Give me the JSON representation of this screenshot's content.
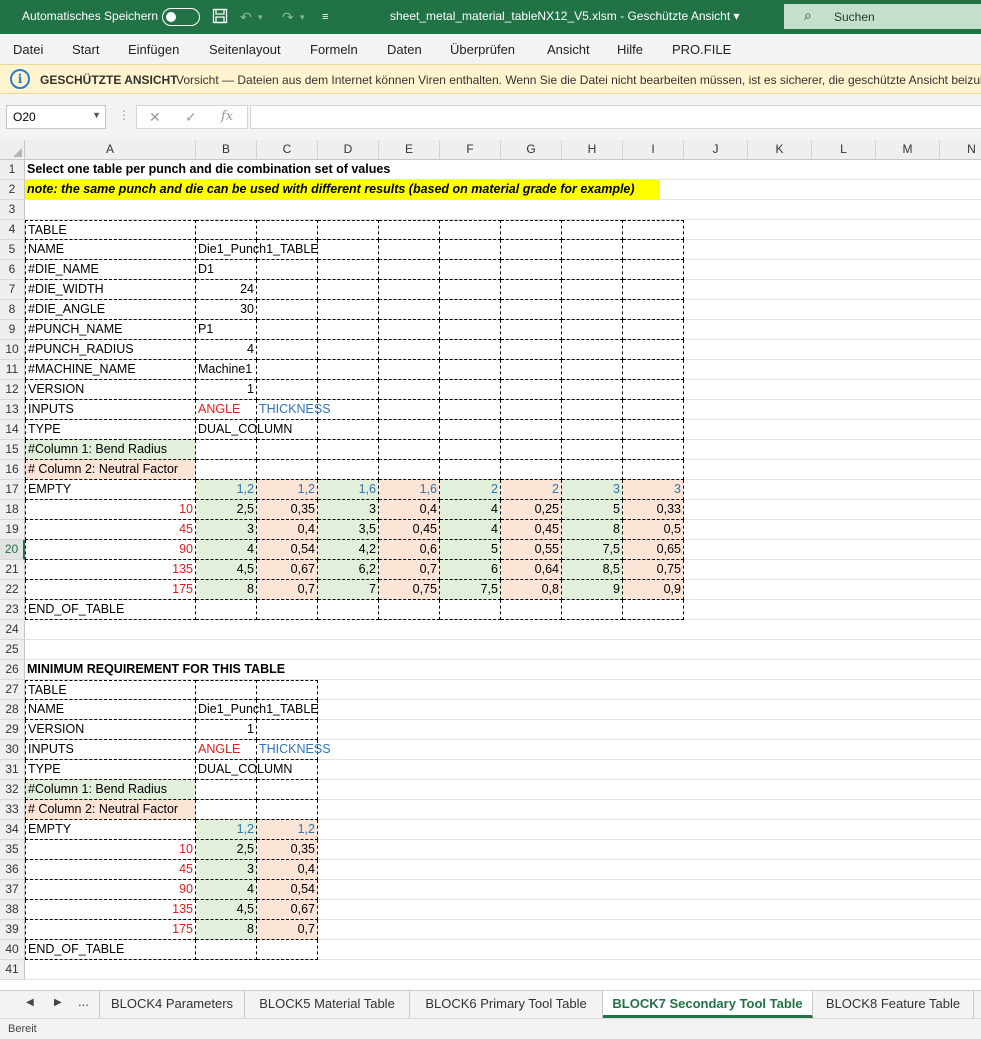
{
  "titlebar": {
    "autosave_label": "Automatisches Speichern",
    "document_title": "sheet_metal_material_tableNX12_V5.xlsm  -  Geschützte Ansicht  ▾",
    "search_label": "Suchen"
  },
  "menu": [
    "Datei",
    "Start",
    "Einfügen",
    "Seitenlayout",
    "Formeln",
    "Daten",
    "Überprüfen",
    "Ansicht",
    "Hilfe",
    "PRO.FILE"
  ],
  "protected_view": {
    "heading": "GESCHÜTZTE ANSICHT",
    "message": "Vorsicht — Dateien aus dem Internet können Viren enthalten. Wenn Sie die Datei nicht bearbeiten müssen, ist es sicherer, die geschützte Ansicht beizubeh"
  },
  "formula_bar": {
    "name_box": "O20",
    "formula": "",
    "fx": "fx"
  },
  "columns": [
    "A",
    "B",
    "C",
    "D",
    "E",
    "F",
    "G",
    "H",
    "I",
    "J",
    "K",
    "L",
    "M",
    "N"
  ],
  "rows": [
    "1",
    "2",
    "3",
    "4",
    "5",
    "6",
    "7",
    "8",
    "9",
    "10",
    "11",
    "12",
    "13",
    "14",
    "15",
    "16",
    "17",
    "18",
    "19",
    "20",
    "21",
    "22",
    "23",
    "24",
    "25",
    "26",
    "27",
    "28",
    "29",
    "30",
    "31",
    "32",
    "33",
    "34",
    "35",
    "36",
    "37",
    "38",
    "39",
    "40",
    "41"
  ],
  "selected_row": "20",
  "cells": {
    "A1": "Select one table per punch and die combination set of values",
    "A2": "note: the same punch and die can be used with different results (based on material grade for example)",
    "A4": "TABLE",
    "A5": "NAME",
    "B5": "Die1_Punch1_TABLE",
    "A6": "#DIE_NAME",
    "B6": "D1",
    "A7": "#DIE_WIDTH",
    "B7": "24",
    "A8": "#DIE_ANGLE",
    "B8": "30",
    "A9": "#PUNCH_NAME",
    "B9": "P1",
    "A10": "#PUNCH_RADIUS",
    "B10": "4",
    "A11": "#MACHINE_NAME",
    "B11": "Machine1",
    "A12": "VERSION",
    "B12": "1",
    "A13": "INPUTS",
    "B13": "ANGLE",
    "C13": "THICKNESS",
    "A14": "TYPE",
    "B14": "DUAL_COLUMN",
    "A15": "#Column 1: Bend Radius",
    "A16": "# Column 2: Neutral Factor",
    "A17": "EMPTY",
    "B17": "1,2",
    "C17": "1,2",
    "D17": "1,6",
    "E17": "1,6",
    "F17": "2",
    "G17": "2",
    "H17": "3",
    "I17": "3",
    "A18": "10",
    "B18": "2,5",
    "C18": "0,35",
    "D18": "3",
    "E18": "0,4",
    "F18": "4",
    "G18": "0,25",
    "H18": "5",
    "I18": "0,33",
    "A19": "45",
    "B19": "3",
    "C19": "0,4",
    "D19": "3,5",
    "E19": "0,45",
    "F19": "4",
    "G19": "0,45",
    "H19": "8",
    "I19": "0,5",
    "A20": "90",
    "B20": "4",
    "C20": "0,54",
    "D20": "4,2",
    "E20": "0,6",
    "F20": "5",
    "G20": "0,55",
    "H20": "7,5",
    "I20": "0,65",
    "A21": "135",
    "B21": "4,5",
    "C21": "0,67",
    "D21": "6,2",
    "E21": "0,7",
    "F21": "6",
    "G21": "0,64",
    "H21": "8,5",
    "I21": "0,75",
    "A22": "175",
    "B22": "8",
    "C22": "0,7",
    "D22": "7",
    "E22": "0,75",
    "F22": "7,5",
    "G22": "0,8",
    "H22": "9",
    "I22": "0,9",
    "A23": "END_OF_TABLE",
    "A26": "MINIMUM REQUIREMENT FOR THIS TABLE",
    "A27": "TABLE",
    "A28": "NAME",
    "B28": "Die1_Punch1_TABLE",
    "A29": "VERSION",
    "B29": "1",
    "A30": "INPUTS",
    "B30": "ANGLE",
    "C30": "THICKNESS",
    "A31": "TYPE",
    "B31": "DUAL_COLUMN",
    "A32": "#Column 1: Bend Radius",
    "A33": "# Column 2: Neutral Factor",
    "A34": "EMPTY",
    "B34": "1,2",
    "C34": "1,2",
    "A35": "10",
    "B35": "2,5",
    "C35": "0,35",
    "A36": "45",
    "B36": "3",
    "C36": "0,4",
    "A37": "90",
    "B37": "4",
    "C37": "0,54",
    "A38": "135",
    "B38": "4,5",
    "C38": "0,67",
    "A39": "175",
    "B39": "8",
    "C39": "0,7",
    "A40": "END_OF_TABLE"
  },
  "sheet_tabs": [
    "BLOCK4 Parameters",
    "BLOCK5 Material Table",
    "BLOCK6 Primary Tool Table",
    "BLOCK7 Secondary Tool Table",
    "BLOCK8 Feature Table"
  ],
  "active_tab": "BLOCK7 Secondary Tool Table",
  "nav": {
    "prev": "◀",
    "next": "▶",
    "more": "..."
  },
  "status": "Bereit",
  "colors": {
    "excel_green": "#217346",
    "green_fill": "#e2efda",
    "peach_fill": "#fce4d6",
    "red_text": "#e0201b",
    "blue_text": "#2e75b6",
    "highlight": "#ffff00"
  }
}
